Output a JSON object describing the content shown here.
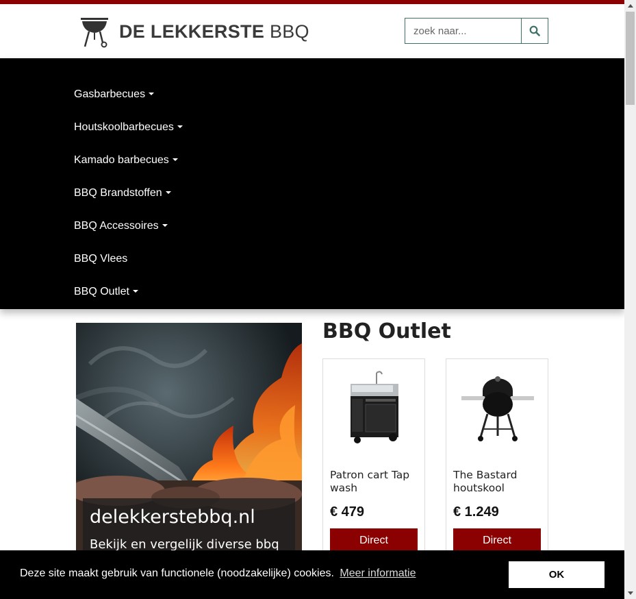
{
  "header": {
    "logo_bold": "DE LEKKERSTE",
    "logo_light": "BBQ",
    "search_placeholder": "zoek naar...",
    "accent_color": "#8b0000"
  },
  "nav": {
    "items": [
      {
        "label": "Gasbarbecues",
        "has_dropdown": true
      },
      {
        "label": "Houtskoolbarbecues",
        "has_dropdown": true
      },
      {
        "label": "Kamado barbecues",
        "has_dropdown": true
      },
      {
        "label": "BBQ Brandstoffen",
        "has_dropdown": true
      },
      {
        "label": "BBQ Accessoires",
        "has_dropdown": true
      },
      {
        "label": "BBQ Vlees",
        "has_dropdown": false
      },
      {
        "label": "BBQ Outlet",
        "has_dropdown": true
      }
    ]
  },
  "hero": {
    "title": "delekkerstebbq.nl",
    "subtitle": "Bekijk en vergelijk diverse bbq"
  },
  "outlet": {
    "title": "BBQ Outlet",
    "products": [
      {
        "name": "Patron cart Tap wash",
        "price": "€ 479",
        "button": "Direct"
      },
      {
        "name": "The Bastard houtskool",
        "price": "€ 1.249",
        "button": "Direct"
      }
    ]
  },
  "cookie": {
    "text": "Deze site maakt gebruik van functionele (noodzakelijke) cookies.",
    "link": "Meer informatie",
    "ok": "OK"
  }
}
